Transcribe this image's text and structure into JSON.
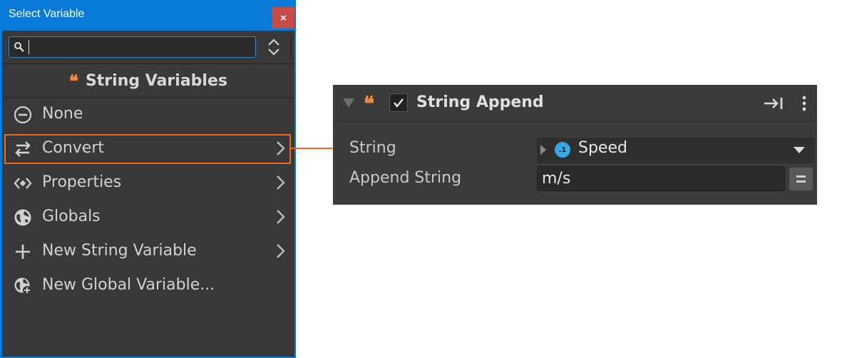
{
  "window": {
    "title": "Select Variable",
    "close_label": "×",
    "search": {
      "value": "",
      "placeholder": ""
    },
    "header": {
      "icon": "quote-icon",
      "title": "String Variables"
    },
    "items": [
      {
        "label": "None",
        "icon": "none-circle-icon",
        "has_submenu": false
      },
      {
        "label": "Convert",
        "icon": "convert-arrows-icon",
        "has_submenu": true,
        "highlighted": true
      },
      {
        "label": "Properties",
        "icon": "properties-icon",
        "has_submenu": true
      },
      {
        "label": "Globals",
        "icon": "globe-icon",
        "has_submenu": true
      },
      {
        "label": "New String Variable",
        "icon": "plus-icon",
        "has_submenu": true
      },
      {
        "label": "New Global Variable...",
        "icon": "globe-add-icon",
        "has_submenu": false
      }
    ]
  },
  "inspector": {
    "title": "String Append",
    "enabled": true,
    "fields": [
      {
        "label": "String",
        "value": "Speed",
        "badge": ".1",
        "type": "variable-dropdown"
      },
      {
        "label": "Append String",
        "value": "m/s",
        "type": "text"
      }
    ]
  },
  "colors": {
    "window_frame": "#0a7ad8",
    "close_button": "#c84a4a",
    "panel_bg": "#393939",
    "accent_orange": "#ee6a1c",
    "quote_orange": "#f08a45",
    "badge_blue": "#35a8e8"
  }
}
